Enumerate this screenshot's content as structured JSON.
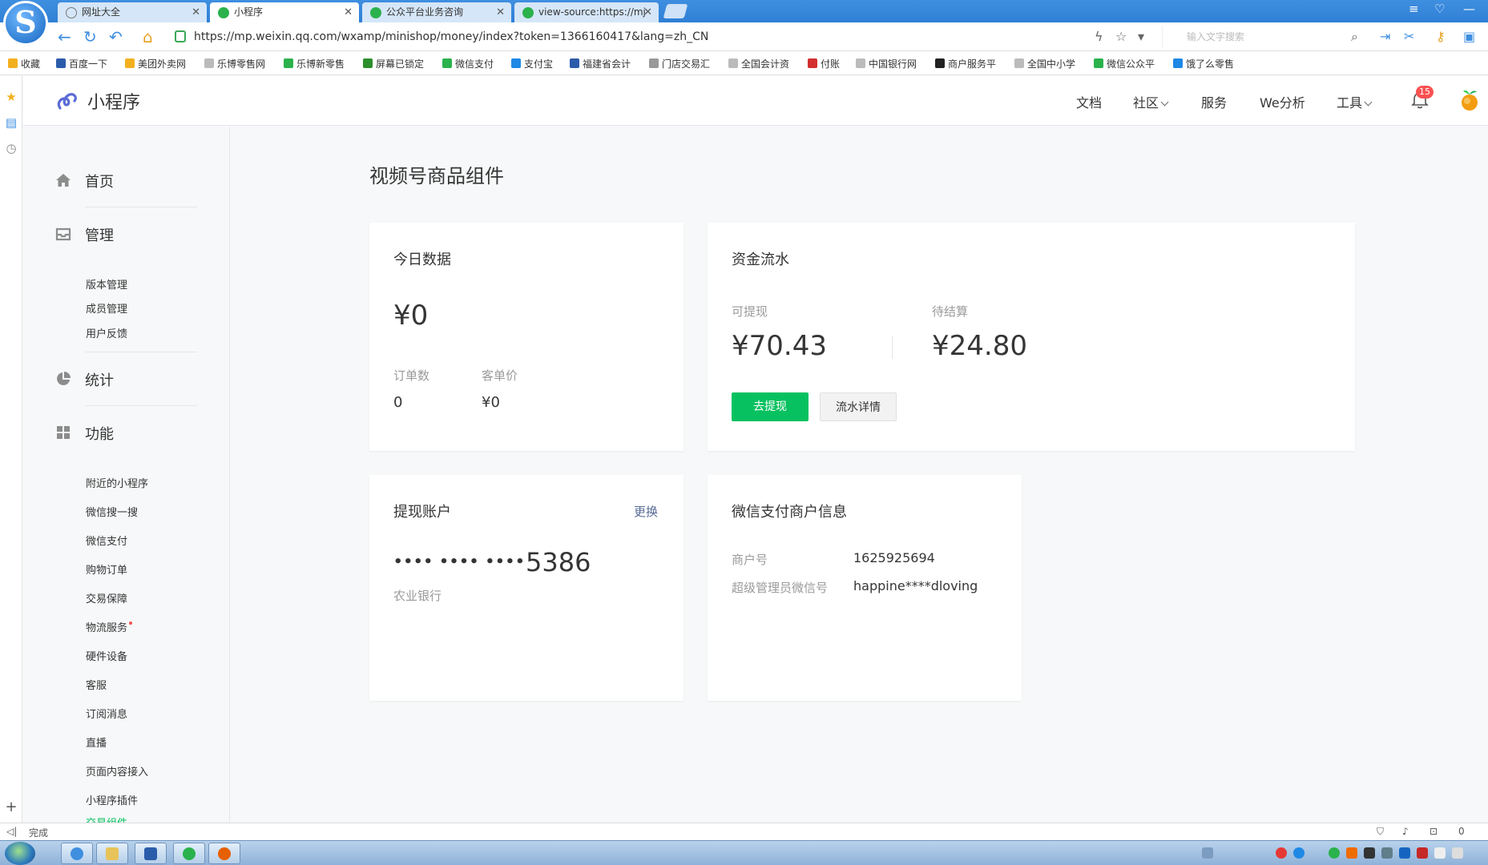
{
  "browser": {
    "logo_letter": "S",
    "tabs": [
      {
        "label": "网址大全",
        "active": false
      },
      {
        "label": "小程序",
        "active": true
      },
      {
        "label": "公众平台业务咨询",
        "active": false
      },
      {
        "label": "view-source:https://mj",
        "active": false
      }
    ],
    "url": "https://mp.weixin.qq.com/wxamp/minishop/money/index?token=1366160417&lang=zh_CN",
    "search_placeholder": "输入文字搜索",
    "bookmarks": [
      "收藏",
      "百度一下",
      "美团外卖网",
      "乐博零售网",
      "乐博新零售",
      "屏幕已锁定",
      "微信支付",
      "支付宝",
      "福建省会计",
      "门店交易汇",
      "全国会计资",
      "付账",
      "中国银行网",
      "商户服务平",
      "全国中小学",
      "微信公众平",
      "饿了么零售"
    ],
    "status_text": "完成",
    "status_right": "0"
  },
  "topbar": {
    "brand": "小程序",
    "nav": [
      {
        "label": "文档",
        "dropdown": false
      },
      {
        "label": "社区",
        "dropdown": true
      },
      {
        "label": "服务",
        "dropdown": false
      },
      {
        "label": "We分析",
        "dropdown": false
      },
      {
        "label": "工具",
        "dropdown": true
      }
    ],
    "notification_count": "15"
  },
  "sidebar": {
    "home": "首页",
    "manage": {
      "label": "管理",
      "items": [
        "版本管理",
        "成员管理",
        "用户反馈"
      ]
    },
    "stats": "统计",
    "features": {
      "label": "功能",
      "items": [
        "附近的小程序",
        "微信搜一搜",
        "微信支付",
        "购物订单",
        "交易保障",
        "物流服务",
        "硬件设备",
        "客服",
        "订阅消息",
        "直播",
        "页面内容接入",
        "小程序插件",
        "交易组件"
      ],
      "active_item": "交易组件",
      "dot_item": "物流服务"
    }
  },
  "main": {
    "title": "视频号商品组件",
    "today": {
      "title": "今日数据",
      "amount": "¥0",
      "orders_label": "订单数",
      "orders_value": "0",
      "avg_label": "客单价",
      "avg_value": "¥0"
    },
    "funds": {
      "title": "资金流水",
      "withdrawable_label": "可提现",
      "withdrawable_value": "¥70.43",
      "pending_label": "待结算",
      "pending_value": "¥24.80",
      "withdraw_button": "去提现",
      "details_button": "流水详情"
    },
    "account": {
      "title": "提现账户",
      "change_link": "更换",
      "masked": "•••• •••• ••••",
      "last4": "5386",
      "bank": "农业银行"
    },
    "merchant": {
      "title": "微信支付商户信息",
      "merchant_no_label": "商户号",
      "merchant_no_value": "1625925694",
      "admin_label": "超级管理员微信号",
      "admin_value": "happine****dloving"
    }
  },
  "colors": {
    "accent_green": "#07c160",
    "link_blue": "#576b95",
    "badge_red": "#fa5151",
    "browser_blue": "#2f7fd6"
  }
}
